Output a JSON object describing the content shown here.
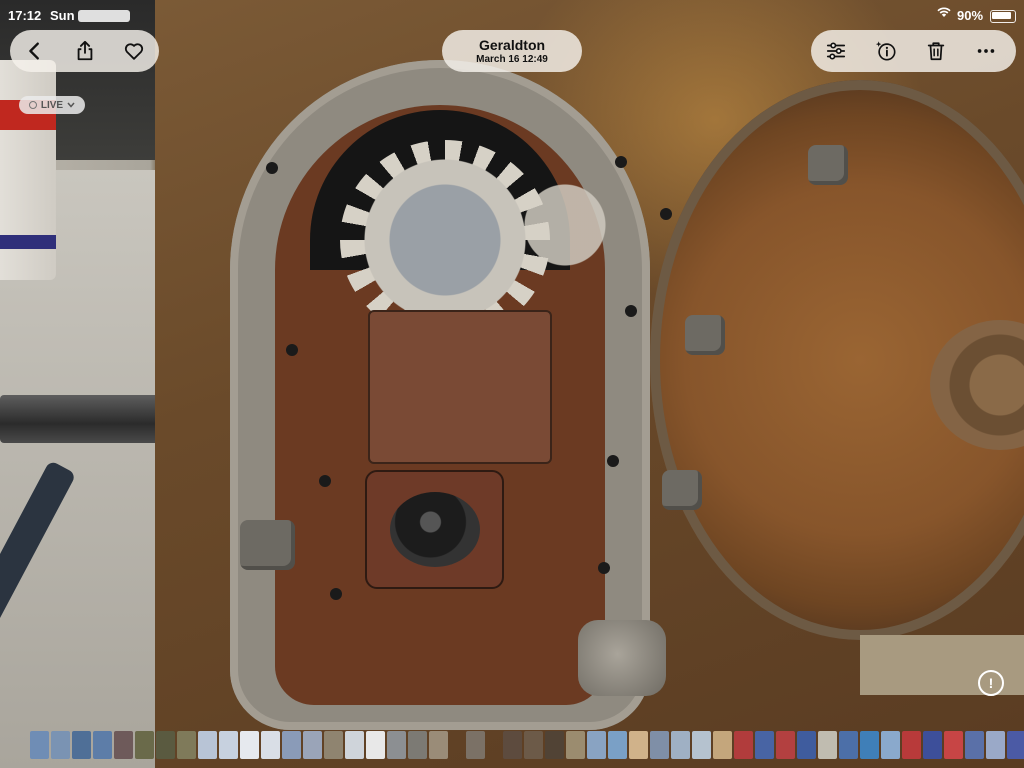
{
  "status_bar": {
    "time": "17:12",
    "date": "Sun",
    "battery_percent": "90%",
    "wifi_icon": "wifi-icon",
    "battery_icon": "battery-icon"
  },
  "toolbar_left": {
    "back_icon": "chevron-left-icon",
    "share_icon": "share-icon",
    "favorite_icon": "heart-icon"
  },
  "photo_title": {
    "location": "Geraldton",
    "datetime": "March 16  12:49"
  },
  "toolbar_right": {
    "adjust_icon": "sliders-icon",
    "info_icon": "sparkle-info-icon",
    "delete_icon": "trash-icon",
    "more_icon": "ellipsis-icon"
  },
  "live_badge": {
    "label": "LIVE",
    "icon": "live-photo-icon"
  },
  "info_button": {
    "label": "!"
  },
  "filmstrip": {
    "thumbnail_colors": [
      "#6f8db5",
      "#7a93b3",
      "#4f6f97",
      "#5d7da8",
      "#6e5a5a",
      "#6a6a4a",
      "#5a5a40",
      "#7f7a5a",
      "#b8c4d6",
      "#c7d1df",
      "#e6e9ee",
      "#d9dee6",
      "#8a9bb8",
      "#9aa4b8",
      "#8f8470",
      "#cfd4da",
      "#e8e8e8",
      "#8c8f92",
      "#7c7a74",
      "#9a8c78",
      "gap",
      "#7b7166",
      "gap",
      "#5d4b3e",
      "#6c5a48",
      "#514335",
      "#9b8c6f",
      "#89a3c2",
      "#7aa0c6",
      "#d0b28a",
      "#7f8fa7",
      "#9fb0c4",
      "#b5c2cf",
      "#c4a67c",
      "#b13c3c",
      "#4864a4",
      "#b34040",
      "#3f5c9e",
      "#c0bcb0",
      "#4c6fa8",
      "#3f7fb8",
      "#8aa9cc",
      "#b83a3a",
      "#3d4f9a",
      "#c74545",
      "#5a70a8",
      "#9aa9c8",
      "#4b5aa5"
    ]
  }
}
